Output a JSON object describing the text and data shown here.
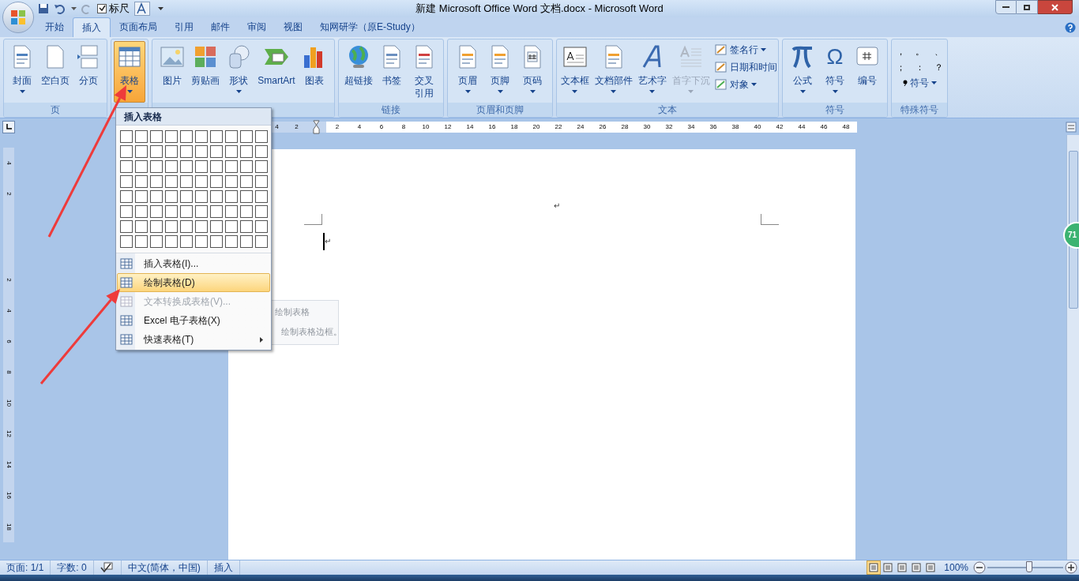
{
  "window": {
    "title": "新建 Microsoft Office Word 文档.docx - Microsoft Word"
  },
  "quick_access": {
    "ruler_checkbox": {
      "label": "标尺",
      "checked": true
    }
  },
  "tabs": [
    {
      "label": "开始",
      "selected": false
    },
    {
      "label": "插入",
      "selected": true
    },
    {
      "label": "页面布局",
      "selected": false
    },
    {
      "label": "引用",
      "selected": false
    },
    {
      "label": "邮件",
      "selected": false
    },
    {
      "label": "审阅",
      "selected": false
    },
    {
      "label": "视图",
      "selected": false
    },
    {
      "label": "知网研学（原E-Study）",
      "selected": false
    }
  ],
  "ribbon_groups": [
    {
      "label": "页",
      "items": [
        {
          "label": "封面",
          "dropdown": true,
          "active": false,
          "disabled": false
        },
        {
          "label": "空白页",
          "dropdown": false,
          "active": false,
          "disabled": false
        },
        {
          "label": "分页",
          "dropdown": false,
          "active": false,
          "disabled": false
        }
      ]
    },
    {
      "items": [
        {
          "label": "表格",
          "dropdown": true,
          "active": true,
          "disabled": false
        }
      ]
    },
    {
      "items": [
        {
          "label": "图片",
          "dropdown": false,
          "active": false,
          "disabled": false
        },
        {
          "label": "剪贴画",
          "dropdown": false,
          "active": false,
          "disabled": false
        },
        {
          "label": "形状",
          "dropdown": true,
          "active": false,
          "disabled": false
        },
        {
          "label": "SmartArt",
          "dropdown": false,
          "active": false,
          "disabled": false
        },
        {
          "label": "图表",
          "dropdown": false,
          "active": false,
          "disabled": false
        }
      ]
    },
    {
      "label": "链接",
      "items": [
        {
          "label": "超链接",
          "dropdown": false,
          "active": false,
          "disabled": false
        },
        {
          "label": "书签",
          "dropdown": false,
          "active": false,
          "disabled": false
        },
        {
          "label": "交叉引用",
          "dropdown": false,
          "active": false,
          "disabled": false,
          "wrap": true
        }
      ]
    },
    {
      "label": "页眉和页脚",
      "items": [
        {
          "label": "页眉",
          "dropdown": true,
          "active": false,
          "disabled": false
        },
        {
          "label": "页脚",
          "dropdown": true,
          "active": false,
          "disabled": false
        },
        {
          "label": "页码",
          "dropdown": true,
          "active": false,
          "disabled": false
        }
      ]
    },
    {
      "label": "文本",
      "items": [
        {
          "label": "文本框",
          "dropdown": true,
          "active": false,
          "disabled": false
        },
        {
          "label": "文档部件",
          "dropdown": true,
          "active": false,
          "disabled": false
        },
        {
          "label": "艺术字",
          "dropdown": true,
          "active": false,
          "disabled": false
        },
        {
          "label": "首字下沉",
          "dropdown": true,
          "active": false,
          "disabled": true
        }
      ],
      "small_items": [
        {
          "label": "签名行",
          "dropdown": true
        },
        {
          "label": "日期和时间",
          "dropdown": false
        },
        {
          "label": "对象",
          "dropdown": true
        }
      ]
    },
    {
      "label": "符号",
      "items": [
        {
          "label": "公式",
          "dropdown": true,
          "active": false,
          "disabled": false
        },
        {
          "label": "符号",
          "glyph": "Ω",
          "dropdown": true,
          "active": false,
          "disabled": false
        },
        {
          "label": "编号",
          "dropdown": false,
          "active": false,
          "disabled": false
        }
      ]
    },
    {
      "label": "特殊符号",
      "chars": [
        "，",
        "。",
        "、",
        "；",
        "：",
        "？"
      ],
      "symbol_button": {
        "label": "符号",
        "dropdown": true
      }
    }
  ],
  "ruler": {
    "left_labels": [
      "4",
      "2"
    ],
    "right_labels": [
      "2",
      "4",
      "6",
      "8",
      "10",
      "12",
      "14",
      "16",
      "18",
      "20",
      "22",
      "24",
      "26",
      "28",
      "30",
      "32",
      "34",
      "36",
      "38",
      "40",
      "42",
      "44",
      "46",
      "48"
    ]
  },
  "vertical_ruler": {
    "labels": [
      "4",
      "2",
      "2",
      "4",
      "6",
      "8",
      "10",
      "12",
      "14",
      "16",
      "18"
    ]
  },
  "document": {
    "header_mark": "↵",
    "paragraph_mark": "↵"
  },
  "table_menu": {
    "header": "插入表格",
    "items": [
      {
        "label": "插入表格(I)...",
        "selected": false,
        "disabled": false,
        "submenu": false
      },
      {
        "label": "绘制表格(D)",
        "selected": true,
        "disabled": false,
        "submenu": false
      },
      {
        "label": "文本转换成表格(V)...",
        "selected": false,
        "disabled": true,
        "submenu": false
      },
      {
        "label": "Excel 电子表格(X)",
        "selected": false,
        "disabled": false,
        "submenu": false
      },
      {
        "label": "快速表格(T)",
        "selected": false,
        "disabled": false,
        "submenu": true
      }
    ]
  },
  "tooltip": {
    "title": "绘制表格",
    "text": "绘制表格边框。"
  },
  "side_badge": "71",
  "status_bar": {
    "page": "页面: 1/1",
    "words": "字数: 0",
    "language": "中文(简体，中国)",
    "mode": "插入",
    "view_buttons": [
      {
        "selected": true
      },
      {
        "selected": false
      },
      {
        "selected": false
      },
      {
        "selected": false
      },
      {
        "selected": false
      }
    ],
    "zoom": "100%",
    "zoom_slider": {
      "level": 0.55
    }
  }
}
